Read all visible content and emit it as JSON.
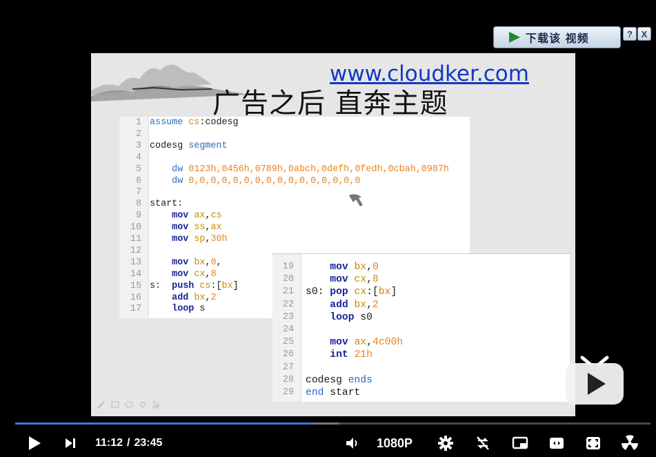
{
  "download_bar": {
    "label": "下载该 视频",
    "help_label": "?",
    "close_label": "X"
  },
  "slide": {
    "url": "www.cloudker.com",
    "title": "广告之后 直奔主题",
    "code_panel_1": [
      {
        "n": "1",
        "html": "<span class='kw'>assume</span> <span class='reg'>cs</span>:codesg"
      },
      {
        "n": "2",
        "html": ""
      },
      {
        "n": "3",
        "html": "codesg <span class='kw'>segment</span>"
      },
      {
        "n": "4",
        "html": ""
      },
      {
        "n": "5",
        "html": "    <span class='kw'>dw</span> <span class='num'>0123h,0456h,0789h,0abch,0defh,0fedh,0cbah,0987h</span>"
      },
      {
        "n": "6",
        "html": "    <span class='kw'>dw</span> <span class='num'>0,0,0,0,0,0,0,0,0,0,0,0,0,0,0,0</span>"
      },
      {
        "n": "7",
        "html": ""
      },
      {
        "n": "8",
        "html": "start:"
      },
      {
        "n": "9",
        "html": "    <span class='ins'>mov</span> <span class='reg'>ax</span>,<span class='reg'>cs</span>"
      },
      {
        "n": "10",
        "html": "    <span class='ins'>mov</span> <span class='reg'>ss</span>,<span class='reg'>ax</span>"
      },
      {
        "n": "11",
        "html": "    <span class='ins'>mov</span> <span class='reg'>sp</span>,<span class='num'>30h</span>"
      },
      {
        "n": "12",
        "html": ""
      },
      {
        "n": "13",
        "html": "    <span class='ins'>mov</span> <span class='reg'>bx</span>,<span class='num'>0</span>,"
      },
      {
        "n": "14",
        "html": "    <span class='ins'>mov</span> <span class='reg'>cx</span>,<span class='num'>8</span>"
      },
      {
        "n": "15",
        "html": "s:  <span class='ins'>push</span> <span class='reg'>cs</span>:[<span class='reg'>bx</span>]"
      },
      {
        "n": "16",
        "html": "    <span class='ins'>add</span> <span class='reg'>bx</span>,<span class='num'>2</span>"
      },
      {
        "n": "17",
        "html": "    <span class='ins'>loop</span> s"
      }
    ],
    "code_panel_2": [
      {
        "n": "19",
        "html": "    <span class='ins'>mov</span> <span class='reg'>bx</span>,<span class='num'>0</span>"
      },
      {
        "n": "20",
        "html": "    <span class='ins'>mov</span> <span class='reg'>cx</span>,<span class='num'>8</span>"
      },
      {
        "n": "21",
        "html": "s0: <span class='ins'>pop</span> <span class='reg'>cx</span>:[<span class='reg'>bx</span>]"
      },
      {
        "n": "22",
        "html": "    <span class='ins'>add</span> <span class='reg'>bx</span>,<span class='num'>2</span>"
      },
      {
        "n": "23",
        "html": "    <span class='ins'>loop</span> s0"
      },
      {
        "n": "24",
        "html": ""
      },
      {
        "n": "25",
        "html": "    <span class='ins'>mov</span> <span class='reg'>ax</span>,<span class='num'>4c00h</span>"
      },
      {
        "n": "26",
        "html": "    <span class='ins'>int</span> <span class='num'>21h</span>"
      },
      {
        "n": "27",
        "html": ""
      },
      {
        "n": "28",
        "html": "codesg <span class='kw'>ends</span>"
      },
      {
        "n": "29",
        "html": "<span class='kw'>end</span> start"
      }
    ]
  },
  "player": {
    "current_time": "11:12",
    "separator": "/",
    "duration": "23:45",
    "quality": "1080P",
    "progress": 0.47,
    "buffered": 0.51,
    "icons": {
      "play": "play-icon",
      "next": "next-icon",
      "volume": "volume-icon",
      "settings": "gear-icon",
      "loop": "loop-off-icon",
      "pip": "pip-icon",
      "widescreen": "widescreen-icon",
      "fullscreen": "fullscreen-icon",
      "radiation": "radiation-icon"
    },
    "accent": "#3a7bd5"
  }
}
